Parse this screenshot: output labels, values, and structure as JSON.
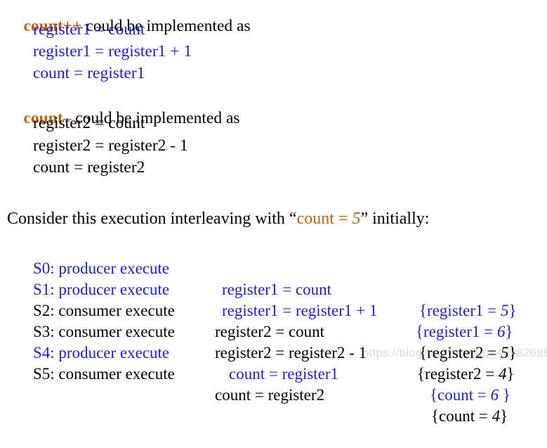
{
  "slide": {
    "background_color": "#ffffff",
    "accent_orange": "#C1620B",
    "accent_blue": "#2020CC",
    "text_black": "#000000"
  },
  "increment_block": {
    "keyword": "count++",
    "heading_rest": " could be implemented as",
    "lines": [
      "register1 = count",
      "register1 = register1 + 1",
      "count = register1"
    ]
  },
  "decrement_block": {
    "keyword": "count–",
    "heading_rest": " could be implemented as",
    "lines": [
      "register2 = count",
      "register2 = register2 - 1",
      "count = register2"
    ]
  },
  "consider": {
    "prefix": "Consider this execution interleaving with “",
    "highlight_text": "count = ",
    "highlight_value": "5",
    "suffix": "” initially:"
  },
  "execution": {
    "rows": [
      {
        "step": "S0: producer execute",
        "operation": "register1 = count",
        "result": "{register1 = 5}",
        "result_label": "{register1 = ",
        "result_value": "5",
        "result_close": "}",
        "color": "blue"
      },
      {
        "step": "S1: producer execute",
        "operation": "register1 = register1 + 1",
        "result": "{register1 = 6}",
        "result_label": "{register1 = ",
        "result_value": "6",
        "result_close": "}",
        "color": "blue"
      },
      {
        "step": "S2: consumer execute",
        "operation": "register2 = count",
        "result": "{register2 = 5}",
        "result_label": "{register2 = ",
        "result_value": "5",
        "result_close": "}",
        "color": "black"
      },
      {
        "step": "S3: consumer execute",
        "operation": "register2 = register2 - 1",
        "result": "{register2 = 4}",
        "result_label": "{register2 = ",
        "result_value": "4",
        "result_close": "}",
        "color": "black"
      },
      {
        "step": "S4: producer execute",
        "operation": "count = register1",
        "result": "{count = 6 }",
        "result_label": "{count = ",
        "result_value": "6",
        "result_close": " }",
        "color": "blue"
      },
      {
        "step": "S5: consumer execute",
        "operation": "count = register2",
        "result": "{count = 4}",
        "result_label": "{count = ",
        "result_value": "4",
        "result_close": "}",
        "color": "black"
      }
    ]
  },
  "watermark": {
    "text": "https://blog.csdn.net/qq_40982686"
  }
}
